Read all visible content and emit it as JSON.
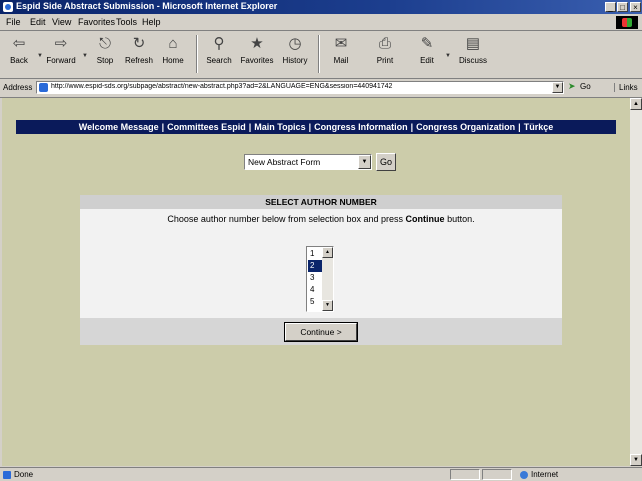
{
  "window": {
    "title": "Espid Side Abstract Submission - Microsoft Internet Explorer",
    "buttons": [
      "_",
      "□",
      "×"
    ]
  },
  "menu": [
    "File",
    "Edit",
    "View",
    "Favorites",
    "Tools",
    "Help"
  ],
  "toolbar": [
    "Back",
    "Forward",
    "Stop",
    "Refresh",
    "Home",
    "Search",
    "Favorites",
    "History",
    "Mail",
    "Print",
    "Edit",
    "Discuss"
  ],
  "toolbar_icons": [
    "back-arrow-icon",
    "forward-arrow-icon",
    "stop-icon",
    "refresh-icon",
    "home-icon",
    "search-icon",
    "favorites-icon",
    "history-icon",
    "mail-icon",
    "print-icon",
    "edit-icon",
    "discuss-icon"
  ],
  "address": {
    "label": "Address",
    "url": "http://www.espid-sds.org/subpage/abstract/new-abstract.php3?ad=2&LANGUAGE=ENG&session=440941742",
    "go_label": "Go",
    "links_label": "Links"
  },
  "nav": [
    "Welcome Message",
    "Committees Espid",
    "Main Topics",
    "Congress Information",
    "Congress Organization",
    "Türkçe"
  ],
  "form_select": {
    "value": "New Abstract Form",
    "go_label": "Go"
  },
  "panel": {
    "header": "SELECT AUTHOR NUMBER",
    "instruction_pre": "Choose author number below from selection box and press",
    "instruction_bold": "Continue",
    "instruction_post": "button.",
    "author_options": [
      "1",
      "2",
      "3",
      "4",
      "5"
    ],
    "selected_option": "2",
    "continue_label": "Continue >"
  },
  "status": {
    "text": "Done",
    "zone": "Internet"
  },
  "colors": {
    "page_bg": "#ccccaa",
    "nav_bg": "#0a1a5a",
    "title_bg": "#0a246a"
  }
}
